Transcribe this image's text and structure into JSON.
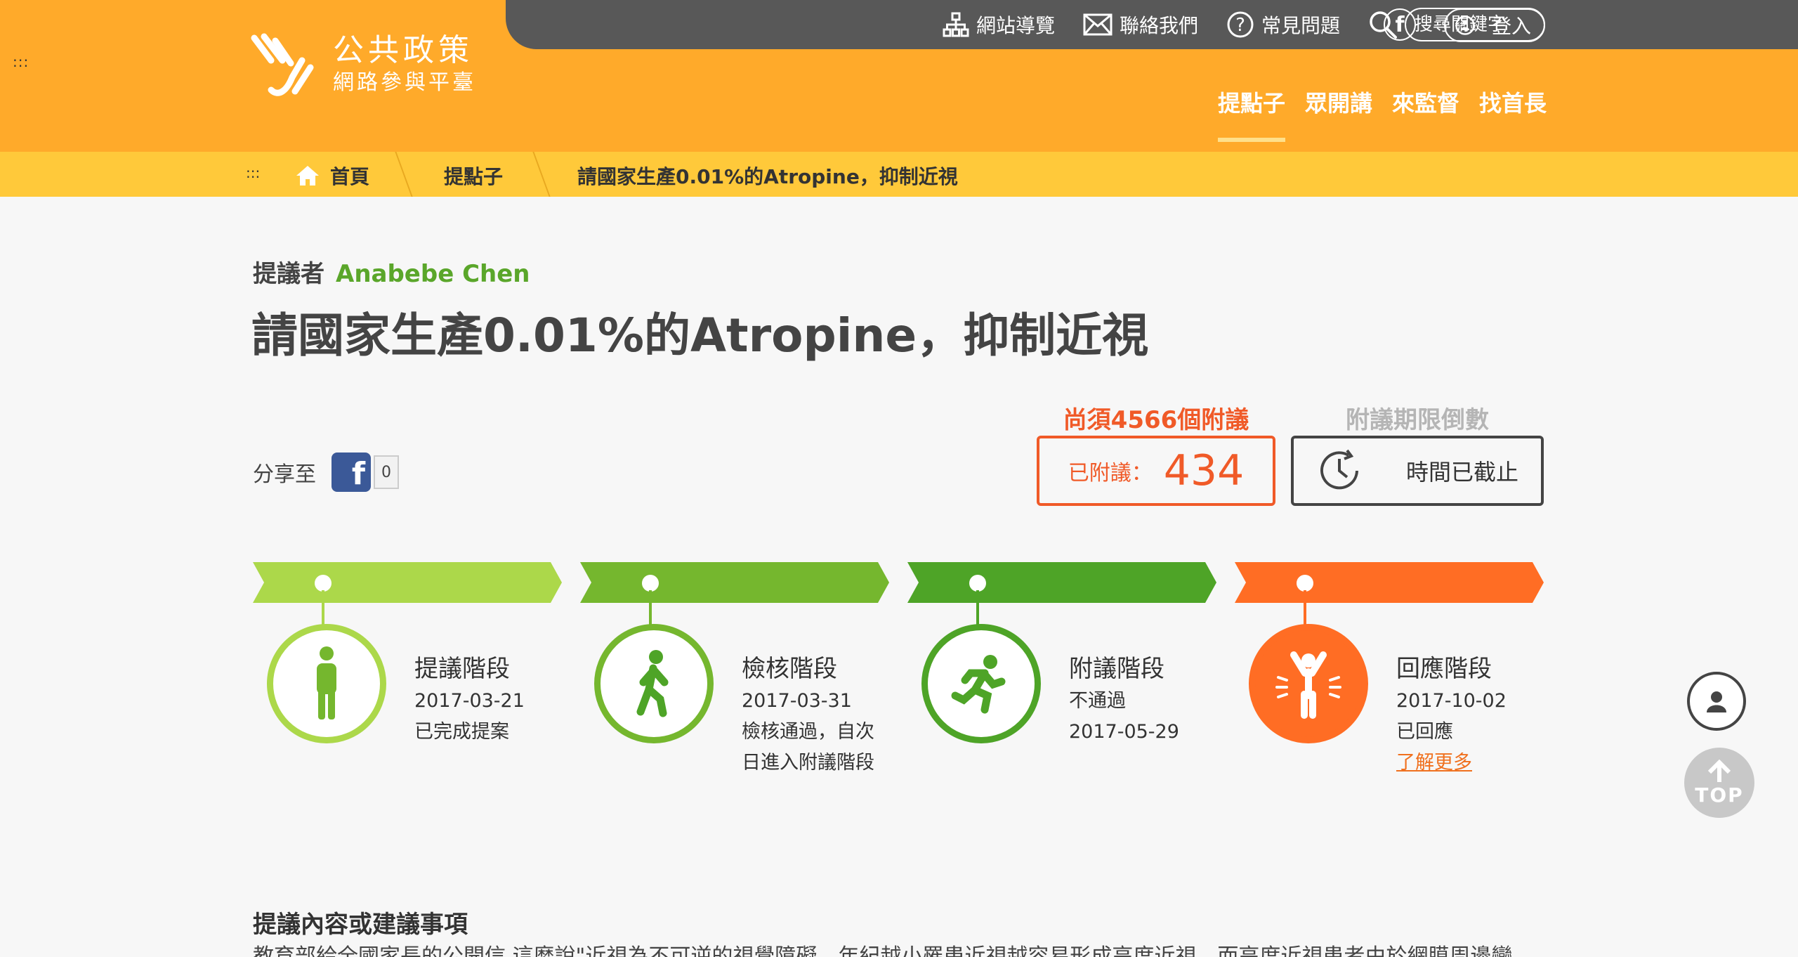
{
  "header": {
    "logo_line1": "公共政策",
    "logo_line2": "網路參與平臺",
    "corner_dots": ":::",
    "top_links": [
      "網站導覽",
      "聯絡我們",
      "常見問題"
    ],
    "search_placeholder": "搜尋關鍵字",
    "facebook_icon": "f",
    "login_label": "登入",
    "main_nav": [
      "提點子",
      "眾開講",
      "來監督",
      "找首長"
    ],
    "active_nav": "提點子"
  },
  "breadcrumb": {
    "dots": ":::",
    "home": "首頁",
    "section": "提點子",
    "current": "請國家生產0.01%的Atropine，抑制近視"
  },
  "proposal": {
    "proposer_label": "提議者",
    "proposer_name": "Anabebe Chen",
    "title": "請國家生產0.01%的Atropine，抑制近視",
    "share_label": "分享至",
    "share_count": "0",
    "need_text": "尚須4566個附議",
    "cosign_label": "已附議：",
    "cosign_count": "434",
    "countdown_label": "附議期限倒數",
    "countdown_status": "時間已截止"
  },
  "stages": [
    {
      "name": "提議階段",
      "line1": "2017-03-21",
      "line2": "已完成提案",
      "line3": "",
      "color": "#acd84a",
      "icon": "standing-person-icon"
    },
    {
      "name": "檢核階段",
      "line1": "2017-03-31",
      "line2": "檢核通過，自次",
      "line3": "日進入附議階段",
      "color": "#75b72e",
      "icon": "walking-person-icon"
    },
    {
      "name": "附議階段",
      "line1": "不通過",
      "line2": "2017-05-29",
      "line3": "",
      "color": "#4ea427",
      "icon": "running-person-icon"
    },
    {
      "name": "回應階段",
      "line1": "2017-10-02",
      "line2": "已回應",
      "line3": "了解更多",
      "color": "#ff6d24",
      "icon": "cheering-person-icon"
    }
  ],
  "float": {
    "top_label": "TOP"
  },
  "content": {
    "heading": "提議內容或建議事項",
    "body": "教育部給全國家長的公開信 這麼說\"近視為不可逆的視覺障礙，年紀越小罹患近視越容易形成高度近視，而高度近視患者由於網膜周邊變"
  }
}
